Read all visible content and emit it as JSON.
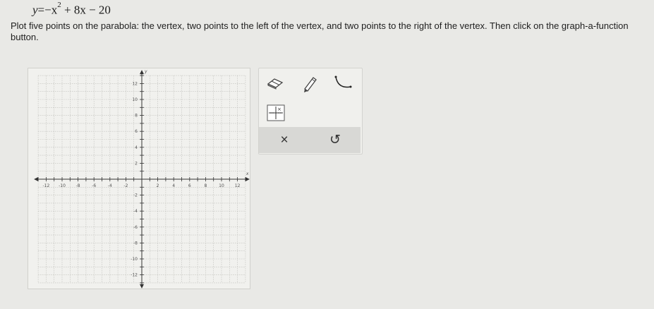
{
  "question": {
    "equation_lhs": "y",
    "equation_eq": "=",
    "equation_rhs_a": "−x",
    "equation_exp": "2",
    "equation_rhs_b": " + 8x − 20",
    "instructions": "Plot five points on the parabola: the vertex, two points to the left of the vertex, and two points to the right of the vertex. Then click on the graph-a-function button."
  },
  "graph": {
    "x_axis_label": "x",
    "y_axis_label": "y",
    "x_tick_labels": [
      "-12",
      "-10",
      "-8",
      "-6",
      "-4",
      "-2",
      "2",
      "4",
      "6",
      "8",
      "10",
      "12"
    ],
    "y_tick_labels": [
      "12",
      "10",
      "8",
      "6",
      "4",
      "2",
      "-2",
      "-4",
      "-6",
      "-8",
      "-10",
      "-12"
    ],
    "x_ticks": [
      -12,
      -10,
      -8,
      -6,
      -4,
      -2,
      2,
      4,
      6,
      8,
      10,
      12
    ],
    "y_ticks": [
      12,
      10,
      8,
      6,
      4,
      2,
      -2,
      -4,
      -6,
      -8,
      -10,
      -12
    ],
    "range": [
      -13,
      13
    ],
    "grid": true
  },
  "tools": {
    "eraser_icon": "eraser-icon",
    "pencil_icon": "pencil-icon",
    "parabola_icon": "parabola-tool-icon",
    "graph_function_icon": "graph-function-icon"
  },
  "actions": {
    "clear_label": "×",
    "undo_label": "↺"
  }
}
